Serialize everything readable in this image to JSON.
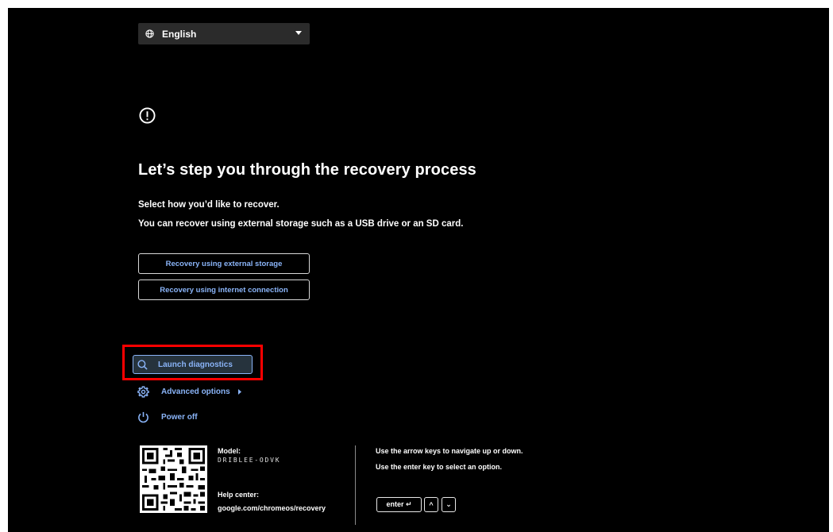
{
  "language_selector": {
    "value": "English"
  },
  "header": {
    "title": "Let’s step you through the recovery process"
  },
  "subtitle": {
    "line1": "Select how you’d like to recover.",
    "line2": "You can recover using external storage such as a USB drive or an SD card."
  },
  "options": [
    {
      "label": "Recovery using external storage"
    },
    {
      "label": "Recovery using internet connection"
    }
  ],
  "menu": {
    "diagnostics_label": "Launch diagnostics",
    "advanced_label": "Advanced options",
    "power_label": "Power off"
  },
  "footer": {
    "model_label": "Model:",
    "model_value": "DRIBLEE-ODVK",
    "help_label": "Help center:",
    "help_value": "google.com/chromeos/recovery",
    "hint_navigate": "Use the arrow keys to navigate up or down.",
    "hint_select": "Use the enter key to select an option.",
    "enter_key_label": "enter ↵",
    "up_key_label": "^",
    "down_key_label": "⌄"
  },
  "icons": {
    "language": "globe-icon",
    "dropdown": "caret-down-icon",
    "alert": "alert-circle-icon",
    "diagnostics": "search-icon",
    "advanced": "gear-icon",
    "advanced_chevron": "chevron-right-icon",
    "power": "power-icon",
    "qr": "qr-code-icon"
  },
  "colors": {
    "background": "#000000",
    "accent": "#8ab4f8",
    "highlight": "#ff0000",
    "text": "#ffffff"
  }
}
